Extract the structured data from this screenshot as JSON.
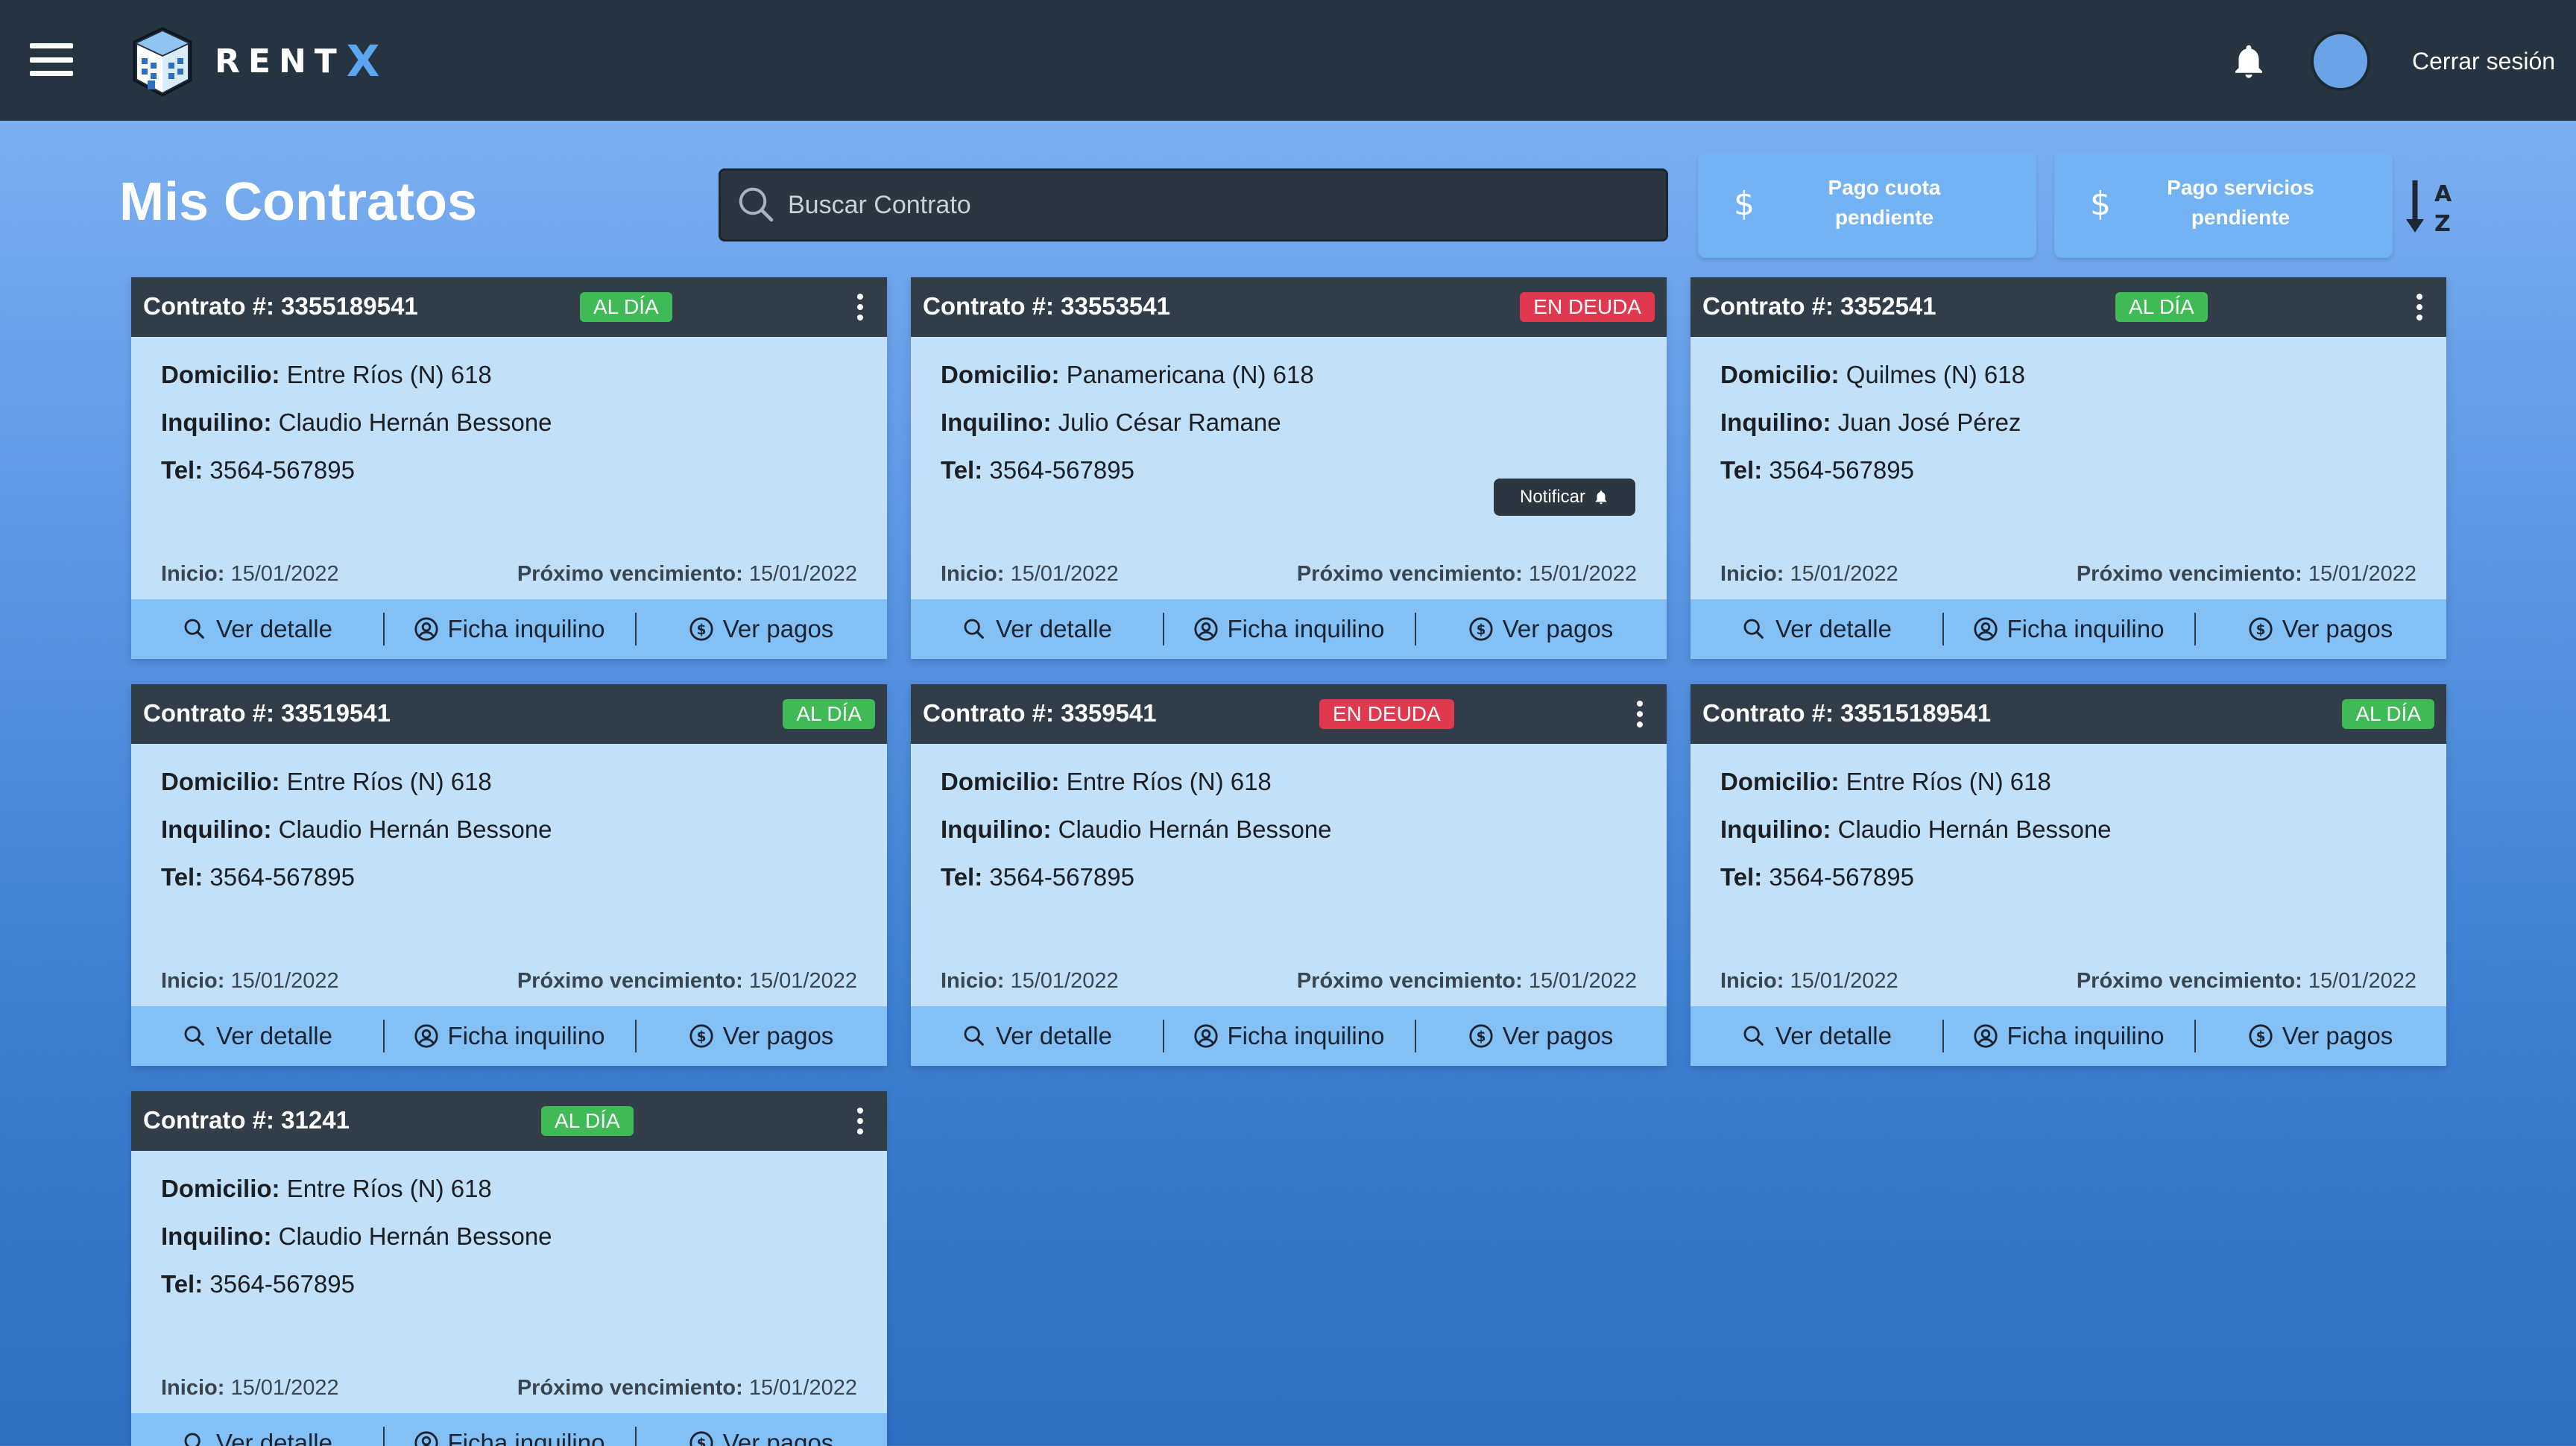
{
  "header": {
    "logo_text": "RENT",
    "logo_x": "X",
    "logout_label": "Cerrar sesión",
    "icons": [
      "menu-icon",
      "building-icon",
      "bell-icon",
      "avatar"
    ]
  },
  "toolbar": {
    "title": "Mis Contratos",
    "search_placeholder": "Buscar Contrato",
    "btn_cuota_line1": "Pago cuota",
    "btn_cuota_line2": "pendiente",
    "btn_servicios_line1": "Pago servicios",
    "btn_servicios_line2": "pendiente",
    "dollar": "$"
  },
  "labels": {
    "domicilio": "Domicilio:",
    "inquilino": "Inquilino:",
    "tel": "Tel:",
    "inicio": "Inicio:",
    "proximo": "Próximo vencimiento:",
    "ver_detalle": "Ver detalle",
    "ficha_inquilino": "Ficha inquilino",
    "ver_pagos": "Ver pagos",
    "notificar": "Notificar"
  },
  "colors": {
    "topbar": "#263340",
    "card_header": "#313d49",
    "card_body": "#c2e1f8",
    "card_actions": "#82c0f5",
    "status_ok": "#3fba56",
    "status_debt": "#e0384f",
    "accent": "#5aa7ef"
  },
  "contracts": [
    {
      "title": "Contrato #: 3355189541",
      "status": "AL DÍA",
      "domicilio": "Entre Ríos (N) 618",
      "inquilino": "Claudio Hernán Bessone",
      "tel": "3564-567895",
      "inicio": "15/01/2022",
      "vencimiento": "15/01/2022"
    },
    {
      "title": "Contrato #: 33553541",
      "status": "EN DEUDA",
      "domicilio": "Panamericana (N) 618",
      "inquilino": "Julio César Ramane",
      "tel": "3564-567895",
      "inicio": "15/01/2022",
      "vencimiento": "15/01/2022"
    },
    {
      "title": "Contrato #: 3352541",
      "status": "AL DÍA",
      "domicilio": "Quilmes (N) 618",
      "inquilino": "Juan José Pérez",
      "tel": "3564-567895",
      "inicio": "15/01/2022",
      "vencimiento": "15/01/2022"
    },
    {
      "title": "Contrato #: 33519541",
      "status": "AL DÍA",
      "domicilio": "Entre Ríos (N) 618",
      "inquilino": "Claudio Hernán Bessone",
      "tel": "3564-567895",
      "inicio": "15/01/2022",
      "vencimiento": "15/01/2022"
    },
    {
      "title": "Contrato #: 3359541",
      "status": "EN DEUDA",
      "domicilio": "Entre Ríos (N) 618",
      "inquilino": "Claudio Hernán Bessone",
      "tel": "3564-567895",
      "inicio": "15/01/2022",
      "vencimiento": "15/01/2022"
    },
    {
      "title": "Contrato #: 33515189541",
      "status": "AL DÍA",
      "domicilio": "Entre Ríos (N) 618",
      "inquilino": "Claudio Hernán Bessone",
      "tel": "3564-567895",
      "inicio": "15/01/2022",
      "vencimiento": "15/01/2022"
    },
    {
      "title": "Contrato #: 31241",
      "status": "AL DÍA",
      "domicilio": "Entre Ríos (N) 618",
      "inquilino": "Claudio Hernán Bessone",
      "tel": "3564-567895",
      "inicio": "15/01/2022",
      "vencimiento": "15/01/2022"
    }
  ]
}
